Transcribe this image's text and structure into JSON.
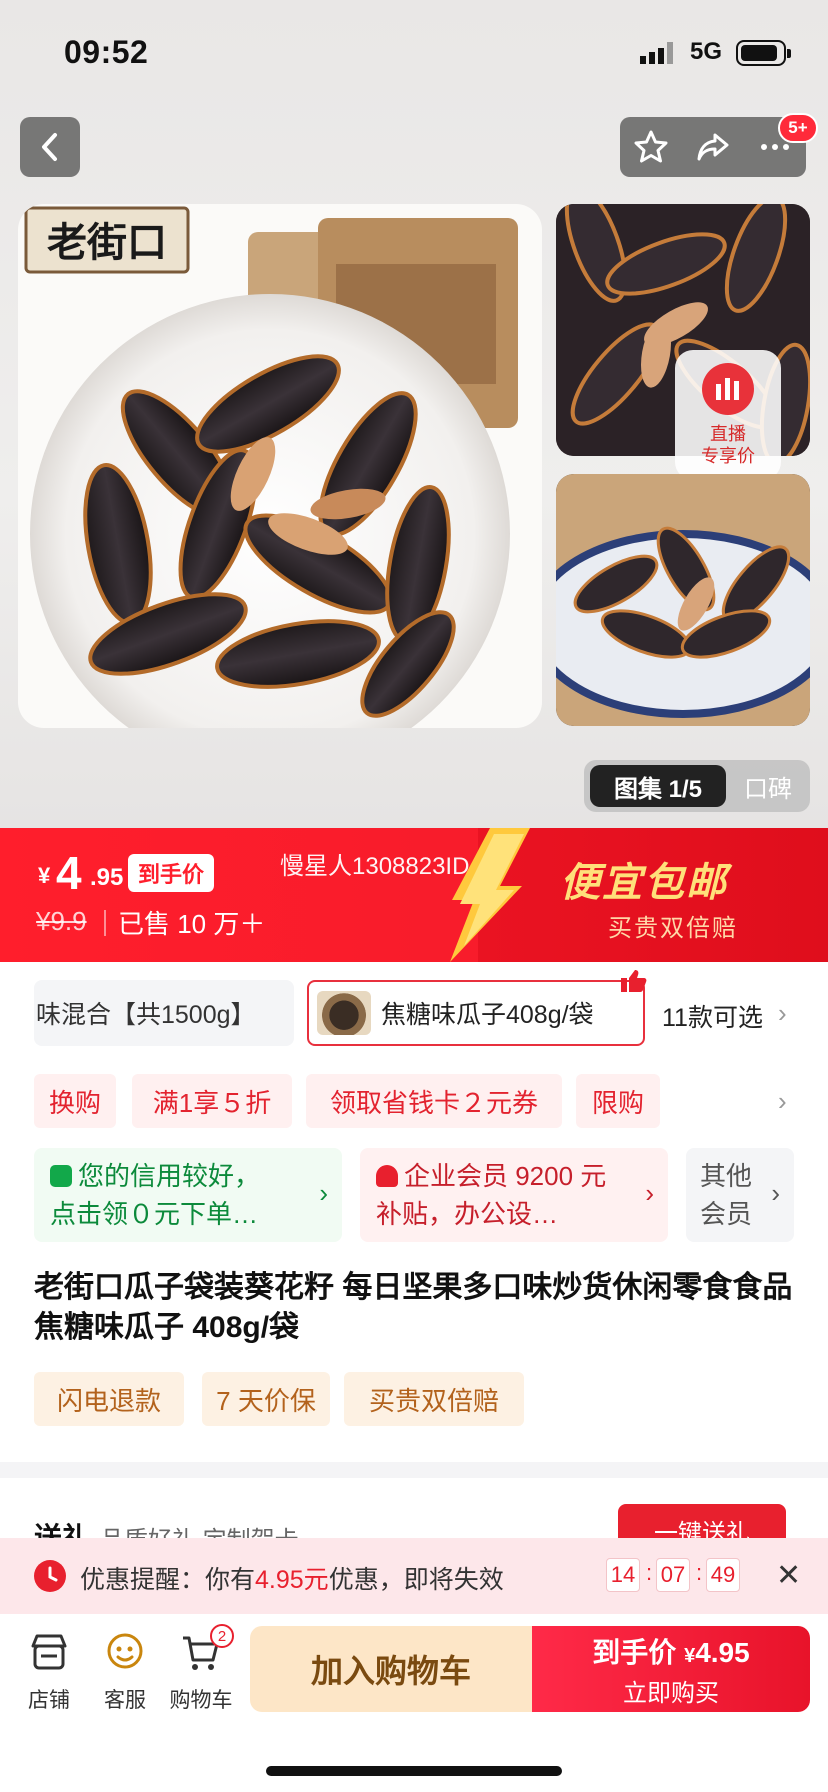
{
  "status_bar": {
    "time": "09:52",
    "network": "5G"
  },
  "header": {
    "notif_badge": "5+",
    "icons": [
      "back-icon",
      "star-icon",
      "share-icon",
      "more-icon"
    ]
  },
  "gallery": {
    "brand_text": "老街口",
    "live_tag": {
      "line1": "直播",
      "line2": "专享价"
    },
    "tab_active": "图集 1/5",
    "tab_other": "口碑"
  },
  "price": {
    "currency": "¥",
    "main": "4",
    "cents": ".95",
    "tag": "到手价",
    "buyer_note": "慢星人1308823ID",
    "old_price": "¥9.9",
    "sold": "已售 10 万＋",
    "slogan": "便宜包邮",
    "slogan_sub": "买贵双倍赔"
  },
  "sku": {
    "chip1": "味混合【共1500g】",
    "chip2": "焦糖味瓜子408g/袋",
    "count": "11款可选"
  },
  "promos": [
    "换购",
    "满1享５折",
    "领取省钱卡２元券",
    "限购"
  ],
  "member_cards": [
    {
      "text": "您的信用较好，点击领０元下单…"
    },
    {
      "text": "企业会员 9200 元补贴，办公设…"
    },
    {
      "text": "其他会员"
    }
  ],
  "product_title": "老街口瓜子袋装葵花籽 每日坚果多口味炒货休闲零食食品 焦糖味瓜子 408g/袋",
  "service_tags": [
    "闪电退款",
    "7 天价保",
    "买贵双倍赔"
  ],
  "gift": {
    "title": "送礼",
    "subtitle": "品质好礼 定制贺卡",
    "button": "一键送礼"
  },
  "reminder": {
    "prefix": "优惠提醒：你有",
    "amount": "4.95元",
    "suffix": "优惠，即将失效",
    "countdown": [
      "14",
      "07",
      "49"
    ]
  },
  "bottom_bar": {
    "shop": "店铺",
    "service": "客服",
    "cart": "购物车",
    "cart_count": "2",
    "add_cart": "加入购物车",
    "buy_price_label": "到手价",
    "buy_currency": "¥",
    "buy_price": "4.95",
    "buy_action": "立即购买"
  },
  "colors": {
    "accent_red": "#e8202e",
    "promo_bg": "#fff0f0",
    "cart_btn": "#fde6c7",
    "slogan": "#ffe07a"
  }
}
